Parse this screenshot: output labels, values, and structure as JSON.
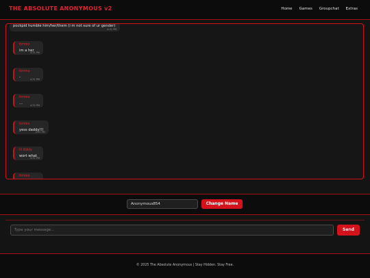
{
  "header": {
    "title": "THE ABSOLUTE ANONYMOUS v2",
    "nav": [
      "Home",
      "Games",
      "Groupchat",
      "Extras"
    ]
  },
  "chat": {
    "messages": [
      {
        "name": "",
        "text": "pockpid humble him/her/them (i m not sure of ur gender)",
        "time": "4:31 PM"
      },
      {
        "name": "timmo",
        "text": "im a her",
        "time": "4:31 PM"
      },
      {
        "name": "timmo",
        "text": "-",
        "time": "4:31 PM"
      },
      {
        "name": "timmo",
        "text": "...",
        "time": "4:32 PM"
      },
      {
        "name": "timmo",
        "text": "yess daddy!!!",
        "time": "4:32 PM"
      },
      {
        "name": "lil diddy",
        "text": "wort what",
        "time": "4:32 PM"
      },
      {
        "name": "timmo",
        "text": "",
        "time": ""
      }
    ]
  },
  "name_bar": {
    "value": "Anonymous854",
    "button": "Change Name"
  },
  "composer": {
    "placeholder": "Type your message...",
    "send": "Send"
  },
  "footer": {
    "text": "© 2025 The Absolute Anonymous | Stay Hidden. Stay Free."
  },
  "colors": {
    "accent": "#d4121c",
    "background": "#141414",
    "header": "#0c0c0c"
  }
}
